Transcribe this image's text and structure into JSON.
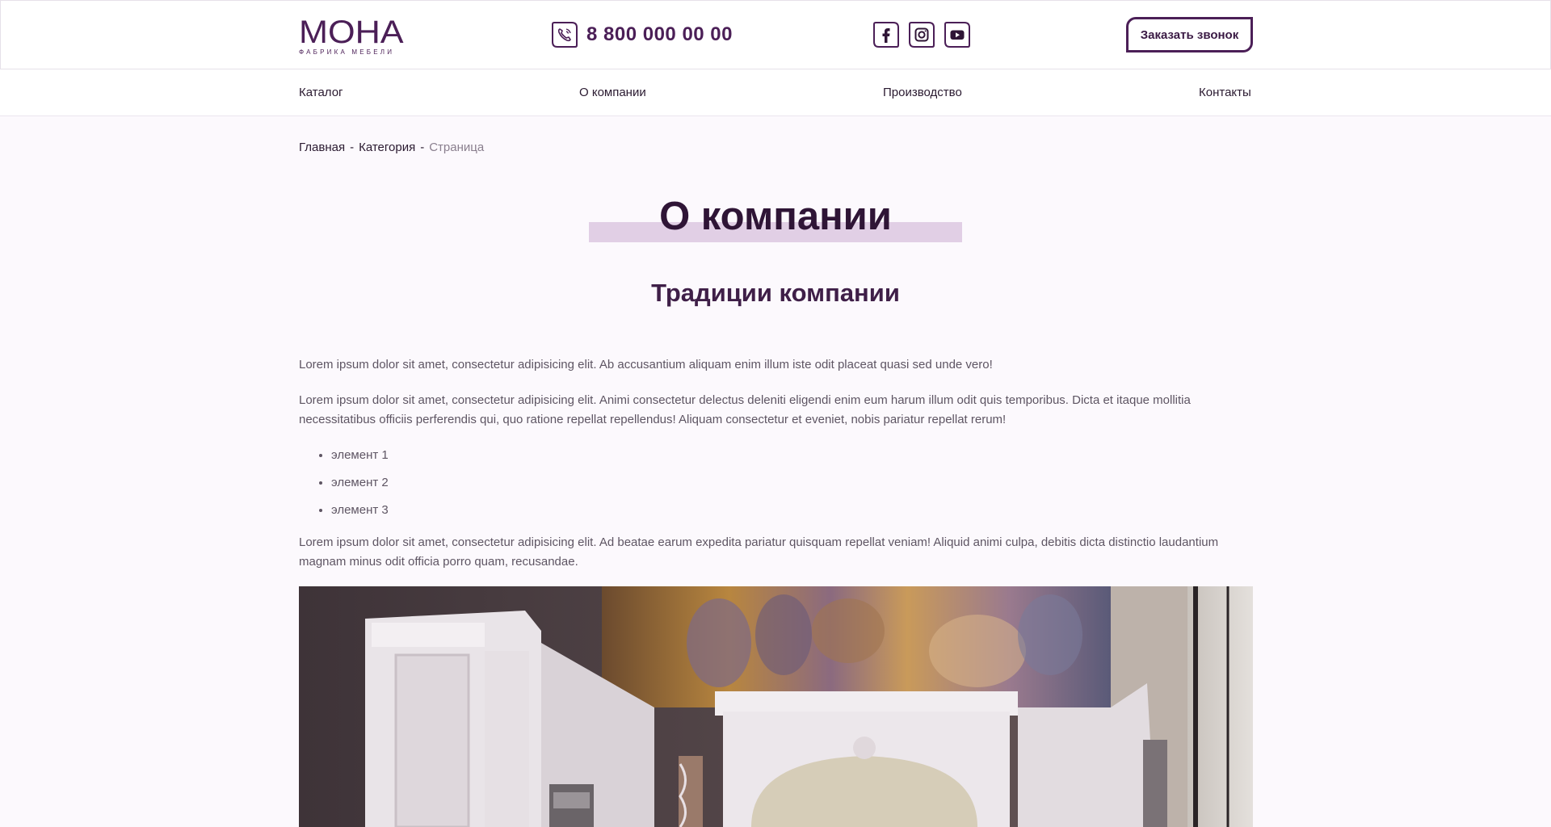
{
  "brand": {
    "logo_text": "МОНА",
    "logo_subtitle": "ФАБРИКА МЕБЕЛИ",
    "accent_color": "#4b1f57"
  },
  "header": {
    "phone": "8 800 000 00 00",
    "phone_icon": "phone-icon",
    "social_icons": [
      "facebook-icon",
      "instagram-icon",
      "youtube-icon"
    ],
    "call_button_label": "Заказать звонок"
  },
  "nav": {
    "items": [
      "Каталог",
      "О компании",
      "Производство",
      "Контакты"
    ]
  },
  "breadcrumb": {
    "items": [
      "Главная",
      "Категория"
    ],
    "separator": "-",
    "current": "Страница"
  },
  "page": {
    "title": "О компании",
    "subtitle": "Традиции компании",
    "paragraph_1": "Lorem ipsum dolor sit amet, consectetur adipisicing elit. Ab accusantium aliquam enim illum iste odit placeat quasi sed unde vero!",
    "paragraph_2": "Lorem ipsum dolor sit amet, consectetur adipisicing elit. Animi consectetur delectus deleniti eligendi enim eum harum illum odit quis temporibus. Dicta et itaque mollitia necessitatibus officiis perferendis qui, quo ratione repellat repellendus! Aliquam consectetur et eveniet, nobis pariatur repellat rerum!",
    "list": [
      "элемент 1",
      "элемент 2",
      "элемент 3"
    ],
    "paragraph_3": "Lorem ipsum dolor sit amet, consectetur adipisicing elit. Ad beatae earum expedita pariatur quisquam repellat veniam! Aliquid animi culpa, debitis dicta distinctio laudantium magnam minus odit officia porro quam, recusandae."
  }
}
